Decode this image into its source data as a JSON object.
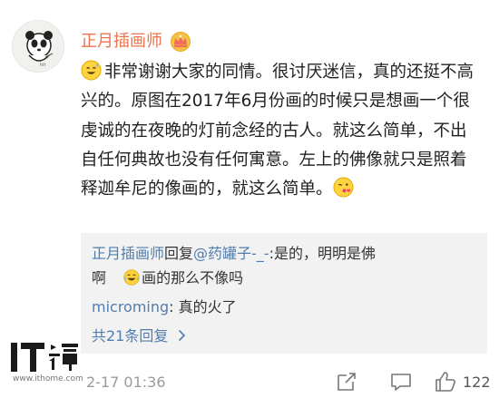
{
  "post": {
    "username": "正月插画师",
    "badge": "crown-badge-icon",
    "text": "非常谢谢大家的同情。很讨厌迷信，真的还挺不高兴的。原图在2017年6月份画的时候只是想画一个很虔诚的在夜晚的灯前念经的古人。就这么简单，不出自任何典故也没有任何寓意。左上的佛像就只是照着释迦牟尼的像画的，就这么简单。",
    "lead_emoji": "smiling-sweat-emoji",
    "trail_emoji": "kiss-emoji"
  },
  "replies": {
    "reply1": {
      "author": "正月插画师",
      "action": "回复",
      "mention": "@药罐子-_-",
      "text_line1": ":是的，明明是佛",
      "text_line2_a": "啊",
      "text_line2_b": "画的那么不像吗",
      "emoji": "laughing-tears-emoji"
    },
    "reply2": {
      "author": "microming",
      "text": ": 真的火了"
    },
    "more_label": "共21条回复"
  },
  "footer": {
    "timestamp": "2-17 01:36",
    "like_count": "122",
    "icons": [
      "share-icon",
      "comment-icon",
      "like-icon"
    ]
  },
  "watermark": {
    "url": "www.ithome.com"
  },
  "colors": {
    "username": "#eb7350",
    "link": "#507daf",
    "reply_bg": "#f2f2f2"
  }
}
